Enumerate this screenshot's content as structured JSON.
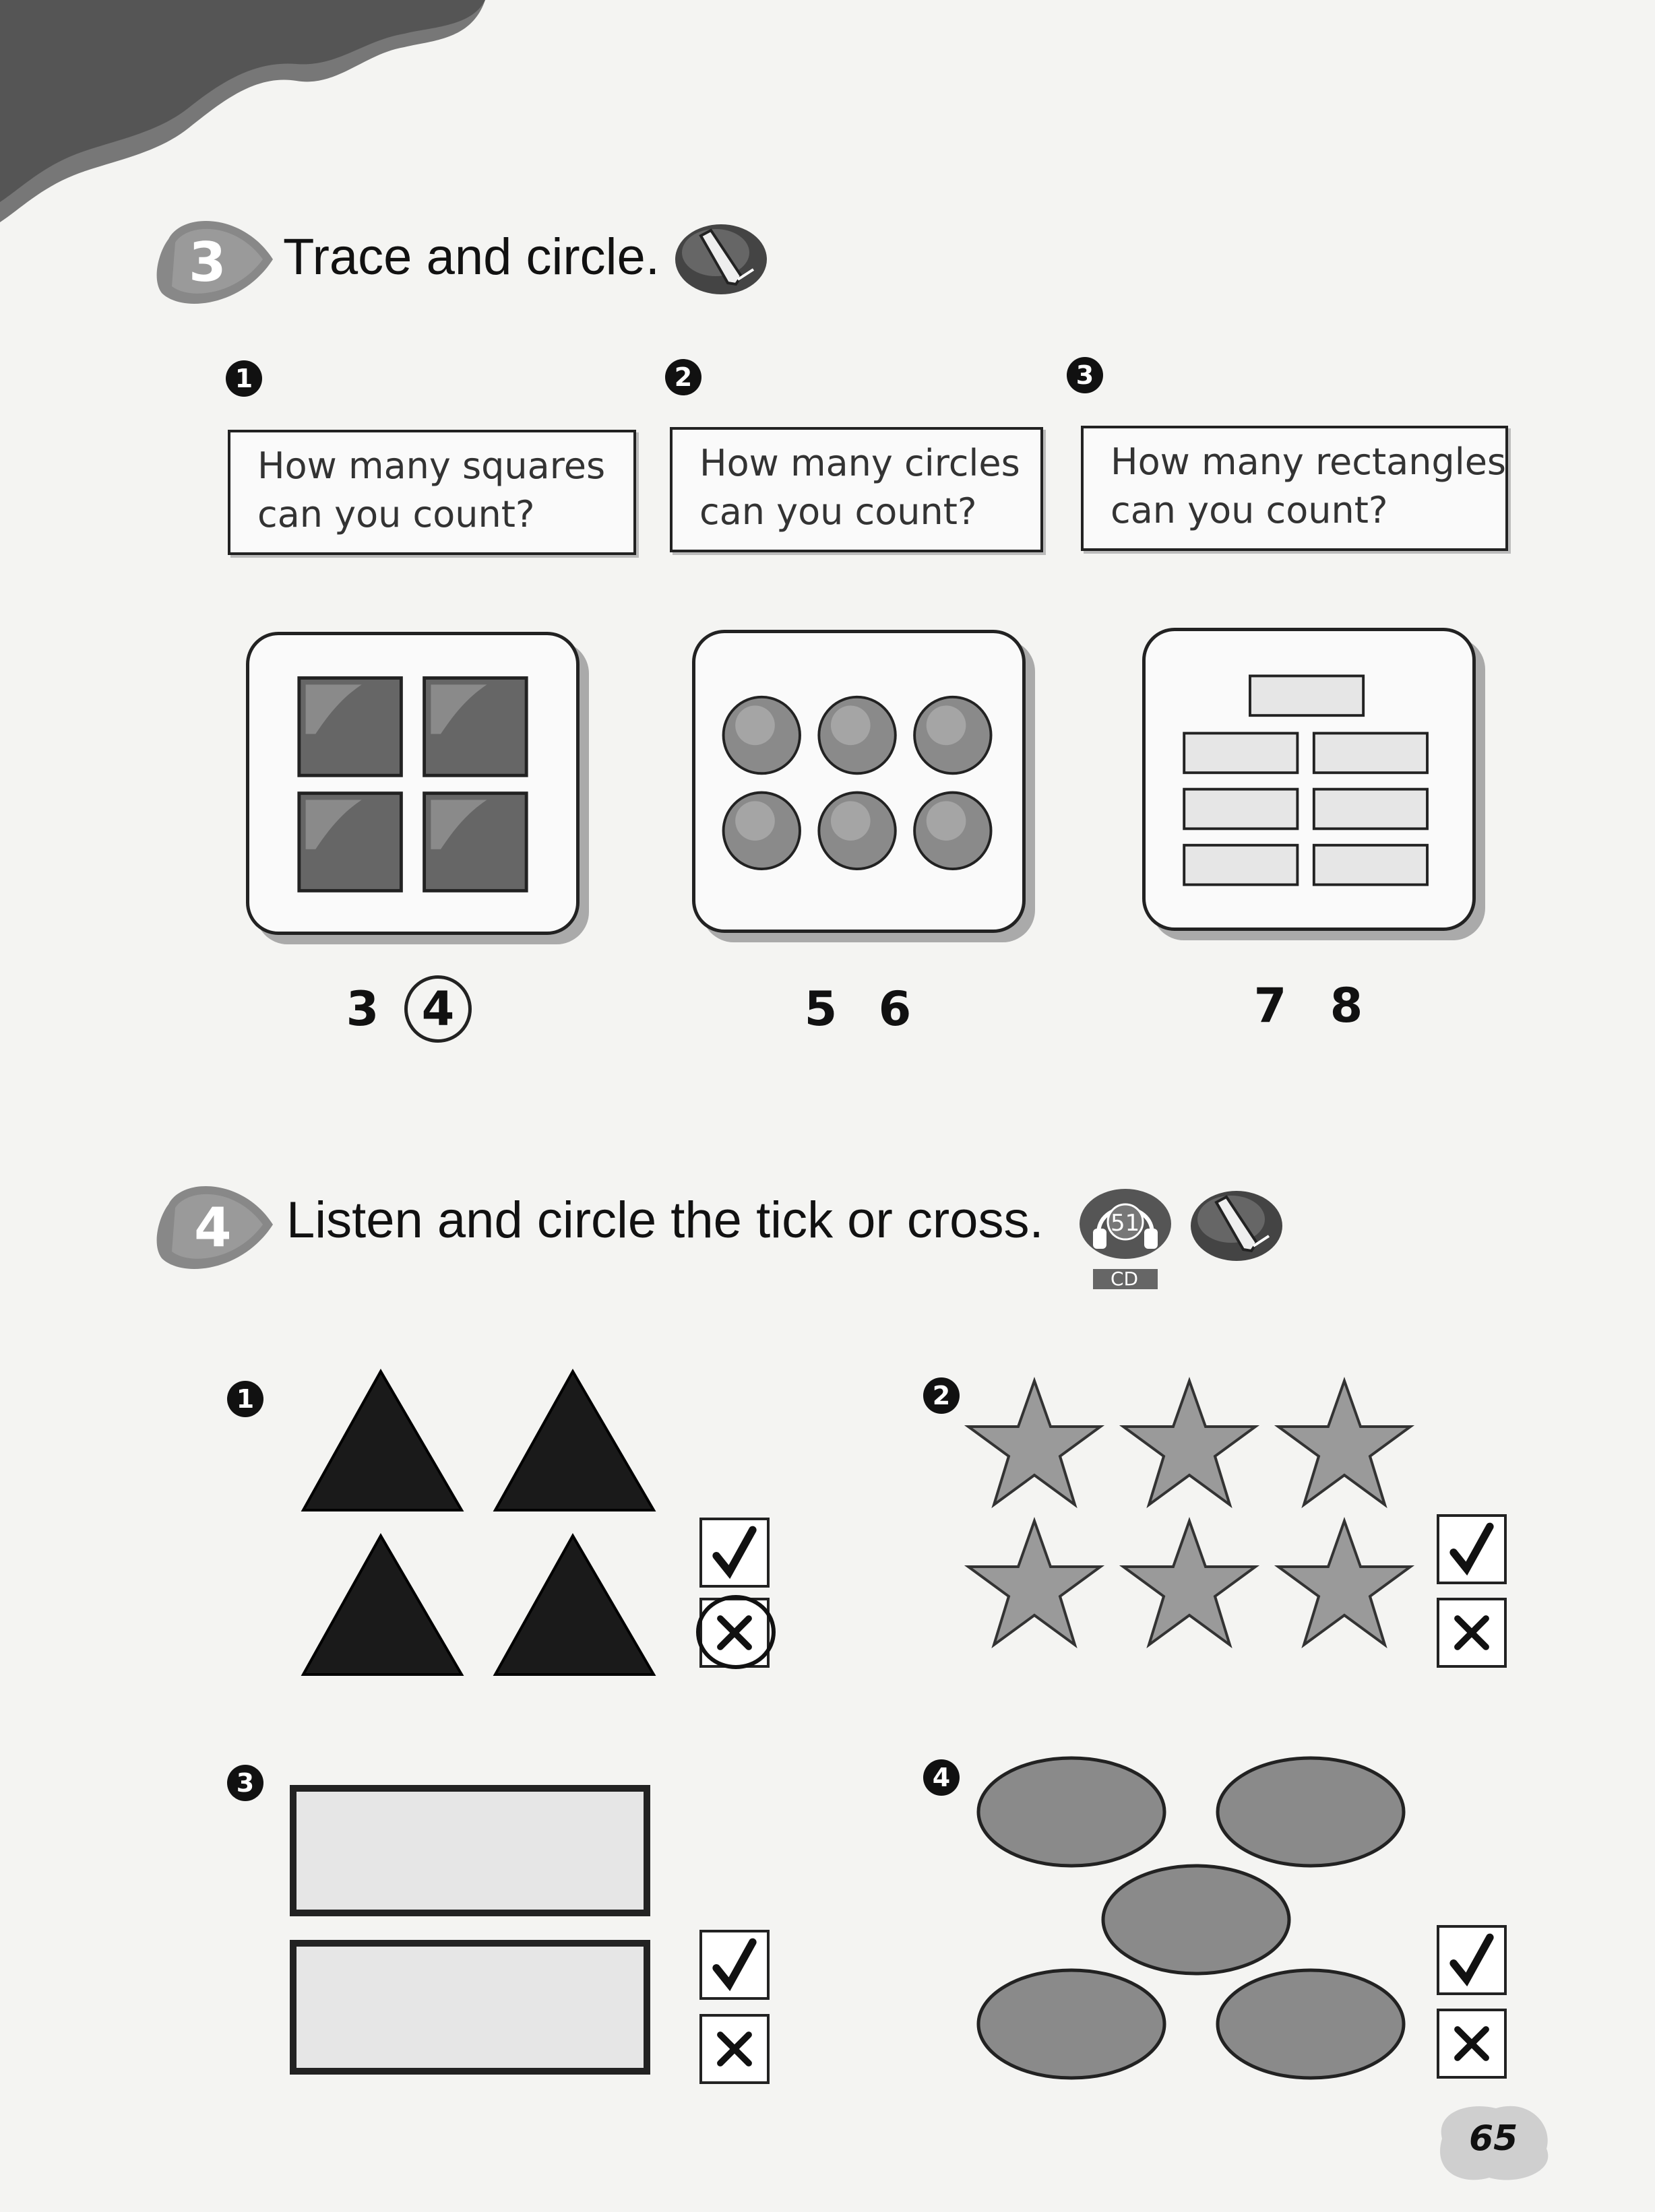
{
  "section3": {
    "badge": "3",
    "title": "Trace and circle.",
    "items": [
      {
        "num": "1",
        "question_line1": "How many squares",
        "question_line2": "can you count?",
        "option_a": "3",
        "option_b": "4",
        "circled": "4"
      },
      {
        "num": "2",
        "question_line1": "How many circles",
        "question_line2": "can you count?",
        "option_a": "5",
        "option_b": "6",
        "circled": ""
      },
      {
        "num": "3",
        "question_line1": "How many rectangles",
        "question_line2": "can you count?",
        "option_a": "7",
        "option_b": "8",
        "circled": ""
      }
    ]
  },
  "section4": {
    "badge": "4",
    "title": "Listen and circle the tick or cross.",
    "cd_track": "51",
    "cd_label": "CD",
    "items": [
      {
        "num": "1",
        "shape": "triangles",
        "count": 4,
        "circled": "cross"
      },
      {
        "num": "2",
        "shape": "stars",
        "count": 6,
        "circled": ""
      },
      {
        "num": "3",
        "shape": "rectangles",
        "count": 2,
        "circled": ""
      },
      {
        "num": "4",
        "shape": "ovals",
        "count": 5,
        "circled": ""
      }
    ]
  },
  "page_number": "65",
  "icons": {
    "pencil": "pencil-icon",
    "cd": "headphones-cd-icon",
    "tick": "tick-icon",
    "cross": "cross-icon"
  }
}
